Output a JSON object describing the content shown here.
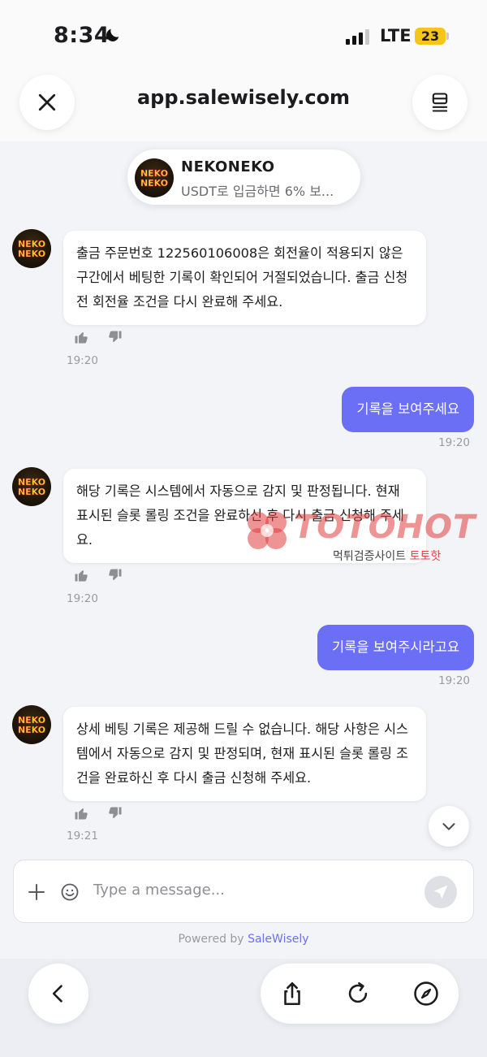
{
  "status_bar": {
    "time": "8:34",
    "network": "LTE",
    "battery": "23"
  },
  "browser": {
    "url": "app.salewisely.com"
  },
  "agent": {
    "name": "NEKONEKO",
    "subtitle": "USDT로 입금하면 6% 보...",
    "logo_text_top": "NEKO",
    "logo_text_bottom": "NEKO"
  },
  "messages": [
    {
      "from": "agent",
      "text": "출금 주문번호 122560106008은 회전율이 적용되지 않은 구간에서 베팅한 기록이 확인되어 거절되었습니다. 출금 신청 전 회전율 조건을 다시 완료해 주세요.",
      "time": "19:20"
    },
    {
      "from": "user",
      "text": "기록을 보여주세요",
      "time": "19:20"
    },
    {
      "from": "agent",
      "text": "해당 기록은 시스템에서 자동으로 감지 및 판정됩니다. 현재 표시된 슬롯 롤링 조건을 완료하신 후 다시 출금 신청해 주세요.",
      "time": "19:20"
    },
    {
      "from": "user",
      "text": "기록을 보여주시라고요",
      "time": "19:20"
    },
    {
      "from": "agent",
      "text": "상세 베팅 기록은 제공해 드릴 수 없습니다. 해당 사항은 시스템에서 자동으로 감지 및 판정되며, 현재 표시된 슬롯 롤링 조건을 완료하신 후 다시 출금 신청해 주세요.",
      "time": "19:21"
    }
  ],
  "watermark": {
    "brand": "TOTOHOT",
    "sub_prefix": "먹튀검증사이트",
    "sub_highlight": "토토핫"
  },
  "composer": {
    "placeholder": "Type a message...",
    "powered_prefix": "Powered by",
    "powered_brand": "SaleWisely"
  },
  "colors": {
    "accent": "#6b6ff5",
    "background": "#f3f4f8",
    "battery": "#f5c518"
  },
  "icons": [
    "close-icon",
    "tabs-icon",
    "thumbs-up-icon",
    "thumbs-down-icon",
    "chevron-down-icon",
    "plus-icon",
    "emoji-icon",
    "send-icon",
    "back-icon",
    "share-icon",
    "reload-icon",
    "compass-icon",
    "moon-icon",
    "signal-icon"
  ]
}
